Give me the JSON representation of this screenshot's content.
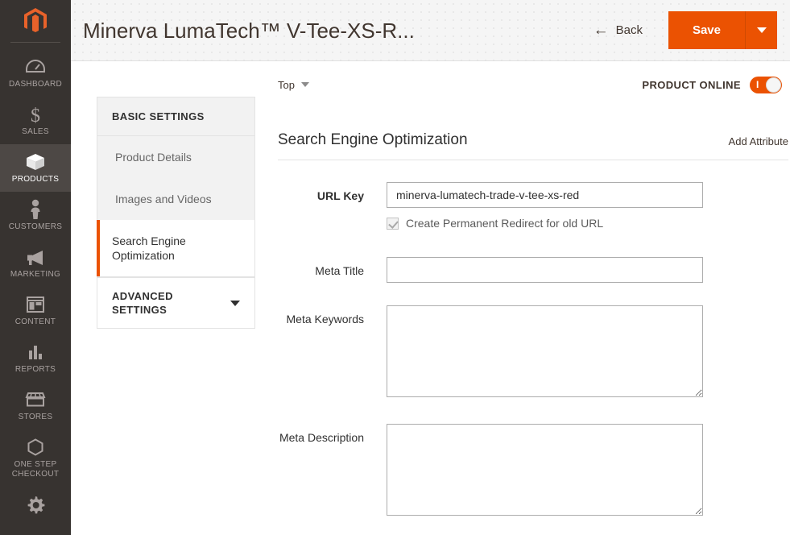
{
  "sidebar": {
    "logo_name": "magento-logo",
    "items": [
      {
        "label": "DASHBOARD",
        "icon": "dashboard-icon",
        "active": false
      },
      {
        "label": "SALES",
        "icon": "dollar-icon",
        "active": false
      },
      {
        "label": "PRODUCTS",
        "icon": "box-icon",
        "active": true
      },
      {
        "label": "CUSTOMERS",
        "icon": "person-icon",
        "active": false
      },
      {
        "label": "MARKETING",
        "icon": "megaphone-icon",
        "active": false
      },
      {
        "label": "CONTENT",
        "icon": "layout-icon",
        "active": false
      },
      {
        "label": "REPORTS",
        "icon": "bar-chart-icon",
        "active": false
      },
      {
        "label": "STORES",
        "icon": "storefront-icon",
        "active": false
      },
      {
        "label": "ONE STEP CHECKOUT",
        "icon": "hexagon-icon",
        "active": false
      },
      {
        "label": "",
        "icon": "gear-icon",
        "active": false
      }
    ]
  },
  "header": {
    "title": "Minerva LumaTech™ V-Tee-XS-R...",
    "back_label": "Back",
    "back_icon": "arrow-left-icon",
    "save_label": "Save",
    "save_caret_icon": "caret-down-icon"
  },
  "settings_nav": {
    "basic_heading": "BASIC SETTINGS",
    "items": [
      {
        "label": "Product Details",
        "active": false
      },
      {
        "label": "Images and Videos",
        "active": false
      },
      {
        "label": "Search Engine Optimization",
        "active": true
      }
    ],
    "advanced_heading": "ADVANCED SETTINGS",
    "advanced_chevron_icon": "chevron-down-icon"
  },
  "toolbar": {
    "scope_label": "Top",
    "scope_caret_icon": "caret-down-icon",
    "online_label": "PRODUCT ONLINE",
    "online_state": "on",
    "toggle_marker": "I"
  },
  "section": {
    "title": "Search Engine Optimization",
    "add_attribute_label": "Add Attribute"
  },
  "form": {
    "url_key": {
      "label": "URL Key",
      "value": "minerva-lumatech-trade-v-tee-xs-red",
      "placeholder": ""
    },
    "redirect_checkbox": {
      "label": "Create Permanent Redirect for old URL",
      "checked": true
    },
    "meta_title": {
      "label": "Meta Title",
      "value": "",
      "placeholder": ""
    },
    "meta_keywords": {
      "label": "Meta Keywords",
      "value": "",
      "placeholder": ""
    },
    "meta_description": {
      "label": "Meta Description",
      "value": "",
      "placeholder": ""
    }
  },
  "colors": {
    "accent": "#eb5202",
    "sidebar_bg": "#373330",
    "sidebar_active_bg": "#4d4845",
    "text_dark": "#303030"
  }
}
